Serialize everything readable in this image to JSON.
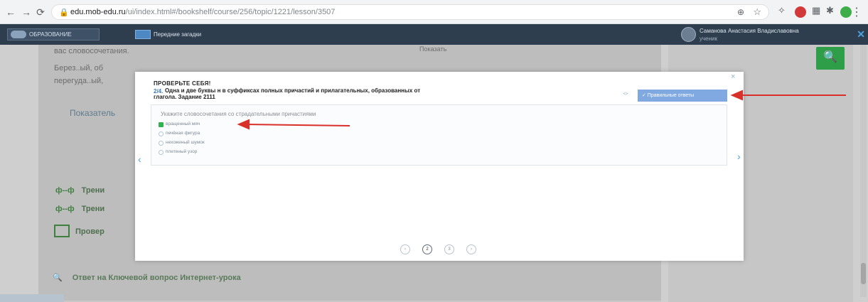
{
  "browser": {
    "back": "←",
    "forward": "→",
    "reload": "⟳",
    "secure_icon": "lock-icon",
    "url_host": "edu.mob-edu.ru",
    "url_path": "/ui/index.html#/bookshelf/course/256/topic/1221/lesson/3507",
    "zoom_icon": "zoom-icon",
    "star": "☆",
    "menu": "⋮"
  },
  "site_header": {
    "logo_text": "ОБРАЗОВАНИЕ",
    "tab_label": "Передние загадки",
    "user_name": "Саманова Анастасия Владиславовна",
    "user_role": "ученик"
  },
  "background": {
    "line1": "вас словосочетания.",
    "line1_right": "Показать",
    "line2": "Берез..ый, об",
    "line3": "перегуда..ый,",
    "link": "Показатель",
    "items": [
      {
        "glyph": "ф--ф",
        "label": "Трени"
      },
      {
        "glyph": "ф--ф",
        "label": "Трени"
      }
    ],
    "check_label": "Провер",
    "bottom": "Ответ на Ключевой вопрос Интернет-урока",
    "bottom_glyph": "🔍"
  },
  "modal": {
    "close": "×",
    "title": "ПРОВЕРЬТЕ СЕБЯ!",
    "question_number": "2/4.",
    "question_title": "Одна и две буквы н в суффиксах полных причастий и прилагательных, образованных от",
    "question_sub": "глагола. Задание 2111",
    "answers_button": "✓ Правильные ответы",
    "prompt": "Укажите словосочетания со страдательными причастиями",
    "options": [
      {
        "label": "вращенный мяч",
        "selected": true
      },
      {
        "label": "печёная фигура",
        "selected": false
      },
      {
        "label": "нехоженый шумок",
        "selected": false
      },
      {
        "label": "плетеный узор",
        "selected": false
      }
    ],
    "prev": "‹",
    "next": "›",
    "pages": [
      "‹",
      "2",
      "3",
      "›"
    ],
    "current_page": "2"
  },
  "colors": {
    "header_bg": "#2f3e4e",
    "accent_green": "#2e9e48",
    "answers_btn": "#7fa9e0",
    "annotation_red": "#d9302a"
  }
}
